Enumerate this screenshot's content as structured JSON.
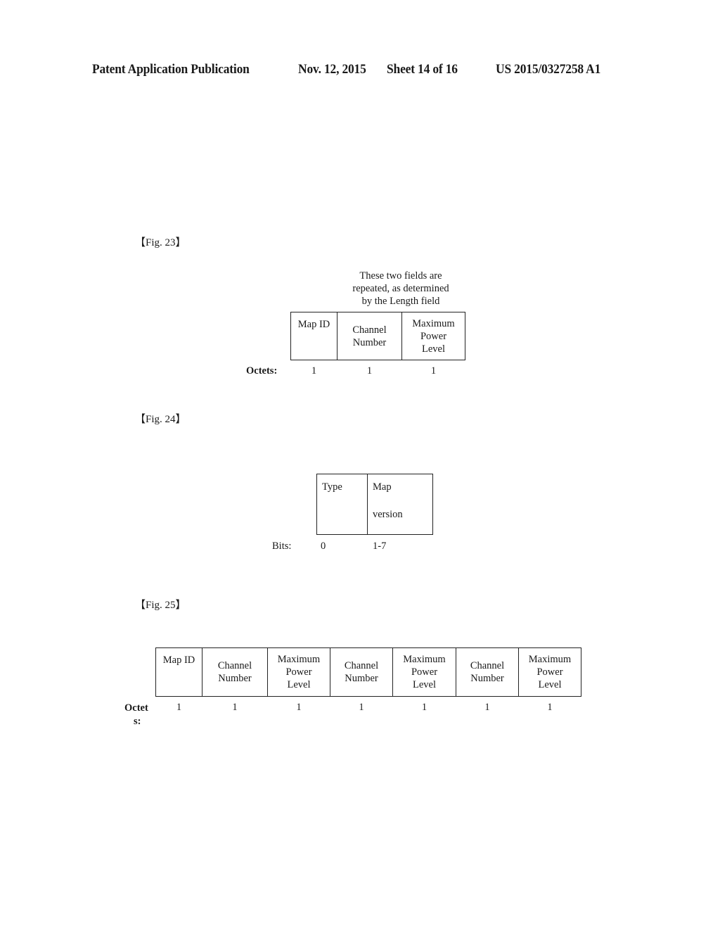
{
  "header": {
    "publication": "Patent Application Publication",
    "date": "Nov. 12, 2015",
    "sheet": "Sheet 14 of 16",
    "number": "US 2015/0327258 A1"
  },
  "fig23": {
    "label": "【Fig. 23】",
    "note_lines": [
      "These two fields are",
      "repeated, as determined",
      "by the Length field"
    ],
    "row_label": "Octets:",
    "fields": [
      {
        "lines": [
          "Map ID"
        ],
        "size": "1"
      },
      {
        "lines": [
          "Channel",
          "Number"
        ],
        "size": "1"
      },
      {
        "lines": [
          "Maximum",
          "Power",
          "Level"
        ],
        "size": "1"
      }
    ]
  },
  "fig24": {
    "label": "【Fig. 24】",
    "row_label": "Bits:",
    "fields": [
      {
        "lines": [
          "Type"
        ],
        "size": "0"
      },
      {
        "lines": [
          "Map",
          "version"
        ],
        "size": "1-7"
      }
    ]
  },
  "fig25": {
    "label": "【Fig. 25】",
    "row_label_lines": [
      "Octet",
      "s:"
    ],
    "fields": [
      {
        "lines": [
          "Map ID"
        ],
        "size": "1"
      },
      {
        "lines": [
          "Channel",
          "Number"
        ],
        "size": "1"
      },
      {
        "lines": [
          "Maximum",
          "Power",
          "Level"
        ],
        "size": "1"
      },
      {
        "lines": [
          "Channel",
          "Number"
        ],
        "size": "1"
      },
      {
        "lines": [
          "Maximum",
          "Power",
          "Level"
        ],
        "size": "1"
      },
      {
        "lines": [
          "Channel",
          "Number"
        ],
        "size": "1"
      },
      {
        "lines": [
          "Maximum",
          "Power",
          "Level"
        ],
        "size": "1"
      }
    ]
  }
}
